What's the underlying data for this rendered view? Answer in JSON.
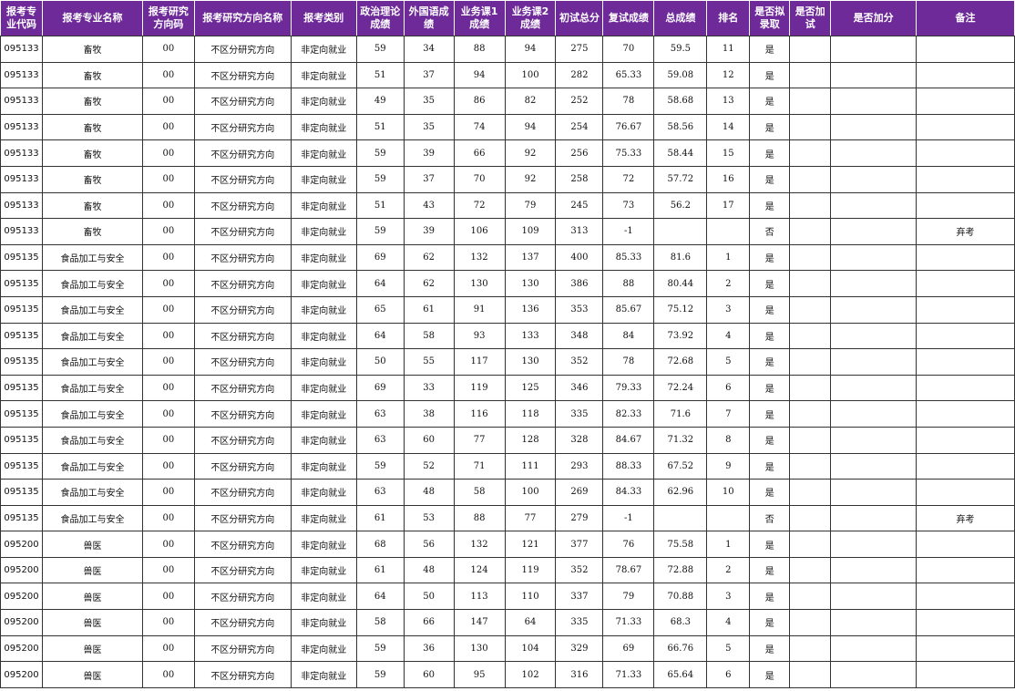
{
  "headers": [
    "报考专业代码",
    "报考专业名称",
    "报考研究方向码",
    "报考研究方向名称",
    "报考类别",
    "政治理论成绩",
    "外国语成绩",
    "业务课1成绩",
    "业务课2成绩",
    "初试总分",
    "复试成绩",
    "总成绩",
    "排名",
    "是否拟录取",
    "是否加试",
    "是否加分",
    "备注"
  ],
  "rows": [
    [
      "095133",
      "畜牧",
      "00",
      "不区分研究方向",
      "非定向就业",
      "59",
      "34",
      "88",
      "94",
      "275",
      "70",
      "59.5",
      "11",
      "是",
      "",
      "",
      ""
    ],
    [
      "095133",
      "畜牧",
      "00",
      "不区分研究方向",
      "非定向就业",
      "51",
      "37",
      "94",
      "100",
      "282",
      "65.33",
      "59.08",
      "12",
      "是",
      "",
      "",
      ""
    ],
    [
      "095133",
      "畜牧",
      "00",
      "不区分研究方向",
      "非定向就业",
      "49",
      "35",
      "86",
      "82",
      "252",
      "78",
      "58.68",
      "13",
      "是",
      "",
      "",
      ""
    ],
    [
      "095133",
      "畜牧",
      "00",
      "不区分研究方向",
      "非定向就业",
      "51",
      "35",
      "74",
      "94",
      "254",
      "76.67",
      "58.56",
      "14",
      "是",
      "",
      "",
      ""
    ],
    [
      "095133",
      "畜牧",
      "00",
      "不区分研究方向",
      "非定向就业",
      "59",
      "39",
      "66",
      "92",
      "256",
      "75.33",
      "58.44",
      "15",
      "是",
      "",
      "",
      ""
    ],
    [
      "095133",
      "畜牧",
      "00",
      "不区分研究方向",
      "非定向就业",
      "59",
      "37",
      "70",
      "92",
      "258",
      "72",
      "57.72",
      "16",
      "是",
      "",
      "",
      ""
    ],
    [
      "095133",
      "畜牧",
      "00",
      "不区分研究方向",
      "非定向就业",
      "51",
      "43",
      "72",
      "79",
      "245",
      "73",
      "56.2",
      "17",
      "是",
      "",
      "",
      ""
    ],
    [
      "095133",
      "畜牧",
      "00",
      "不区分研究方向",
      "非定向就业",
      "59",
      "39",
      "106",
      "109",
      "313",
      "-1",
      "",
      "",
      "否",
      "",
      "",
      "弃考"
    ],
    [
      "095135",
      "食品加工与安全",
      "00",
      "不区分研究方向",
      "非定向就业",
      "69",
      "62",
      "132",
      "137",
      "400",
      "85.33",
      "81.6",
      "1",
      "是",
      "",
      "",
      ""
    ],
    [
      "095135",
      "食品加工与安全",
      "00",
      "不区分研究方向",
      "非定向就业",
      "64",
      "62",
      "130",
      "130",
      "386",
      "88",
      "80.44",
      "2",
      "是",
      "",
      "",
      ""
    ],
    [
      "095135",
      "食品加工与安全",
      "00",
      "不区分研究方向",
      "非定向就业",
      "65",
      "61",
      "91",
      "136",
      "353",
      "85.67",
      "75.12",
      "3",
      "是",
      "",
      "",
      ""
    ],
    [
      "095135",
      "食品加工与安全",
      "00",
      "不区分研究方向",
      "非定向就业",
      "64",
      "58",
      "93",
      "133",
      "348",
      "84",
      "73.92",
      "4",
      "是",
      "",
      "",
      ""
    ],
    [
      "095135",
      "食品加工与安全",
      "00",
      "不区分研究方向",
      "非定向就业",
      "50",
      "55",
      "117",
      "130",
      "352",
      "78",
      "72.68",
      "5",
      "是",
      "",
      "",
      ""
    ],
    [
      "095135",
      "食品加工与安全",
      "00",
      "不区分研究方向",
      "非定向就业",
      "69",
      "33",
      "119",
      "125",
      "346",
      "79.33",
      "72.24",
      "6",
      "是",
      "",
      "",
      ""
    ],
    [
      "095135",
      "食品加工与安全",
      "00",
      "不区分研究方向",
      "非定向就业",
      "63",
      "38",
      "116",
      "118",
      "335",
      "82.33",
      "71.6",
      "7",
      "是",
      "",
      "",
      ""
    ],
    [
      "095135",
      "食品加工与安全",
      "00",
      "不区分研究方向",
      "非定向就业",
      "63",
      "60",
      "77",
      "128",
      "328",
      "84.67",
      "71.32",
      "8",
      "是",
      "",
      "",
      ""
    ],
    [
      "095135",
      "食品加工与安全",
      "00",
      "不区分研究方向",
      "非定向就业",
      "59",
      "52",
      "71",
      "111",
      "293",
      "88.33",
      "67.52",
      "9",
      "是",
      "",
      "",
      ""
    ],
    [
      "095135",
      "食品加工与安全",
      "00",
      "不区分研究方向",
      "非定向就业",
      "63",
      "48",
      "58",
      "100",
      "269",
      "84.33",
      "62.96",
      "10",
      "是",
      "",
      "",
      ""
    ],
    [
      "095135",
      "食品加工与安全",
      "00",
      "不区分研究方向",
      "非定向就业",
      "61",
      "53",
      "88",
      "77",
      "279",
      "-1",
      "",
      "",
      "否",
      "",
      "",
      "弃考"
    ],
    [
      "095200",
      "兽医",
      "00",
      "不区分研究方向",
      "非定向就业",
      "68",
      "56",
      "132",
      "121",
      "377",
      "76",
      "75.58",
      "1",
      "是",
      "",
      "",
      ""
    ],
    [
      "095200",
      "兽医",
      "00",
      "不区分研究方向",
      "非定向就业",
      "61",
      "48",
      "124",
      "119",
      "352",
      "78.67",
      "72.88",
      "2",
      "是",
      "",
      "",
      ""
    ],
    [
      "095200",
      "兽医",
      "00",
      "不区分研究方向",
      "非定向就业",
      "64",
      "50",
      "113",
      "110",
      "337",
      "79",
      "70.88",
      "3",
      "是",
      "",
      "",
      ""
    ],
    [
      "095200",
      "兽医",
      "00",
      "不区分研究方向",
      "非定向就业",
      "58",
      "66",
      "147",
      "64",
      "335",
      "71.33",
      "68.3",
      "4",
      "是",
      "",
      "",
      ""
    ],
    [
      "095200",
      "兽医",
      "00",
      "不区分研究方向",
      "非定向就业",
      "59",
      "36",
      "130",
      "104",
      "329",
      "69",
      "66.76",
      "5",
      "是",
      "",
      "",
      ""
    ],
    [
      "095200",
      "兽医",
      "00",
      "不区分研究方向",
      "非定向就业",
      "59",
      "60",
      "95",
      "102",
      "316",
      "71.33",
      "65.64",
      "6",
      "是",
      "",
      "",
      ""
    ]
  ]
}
